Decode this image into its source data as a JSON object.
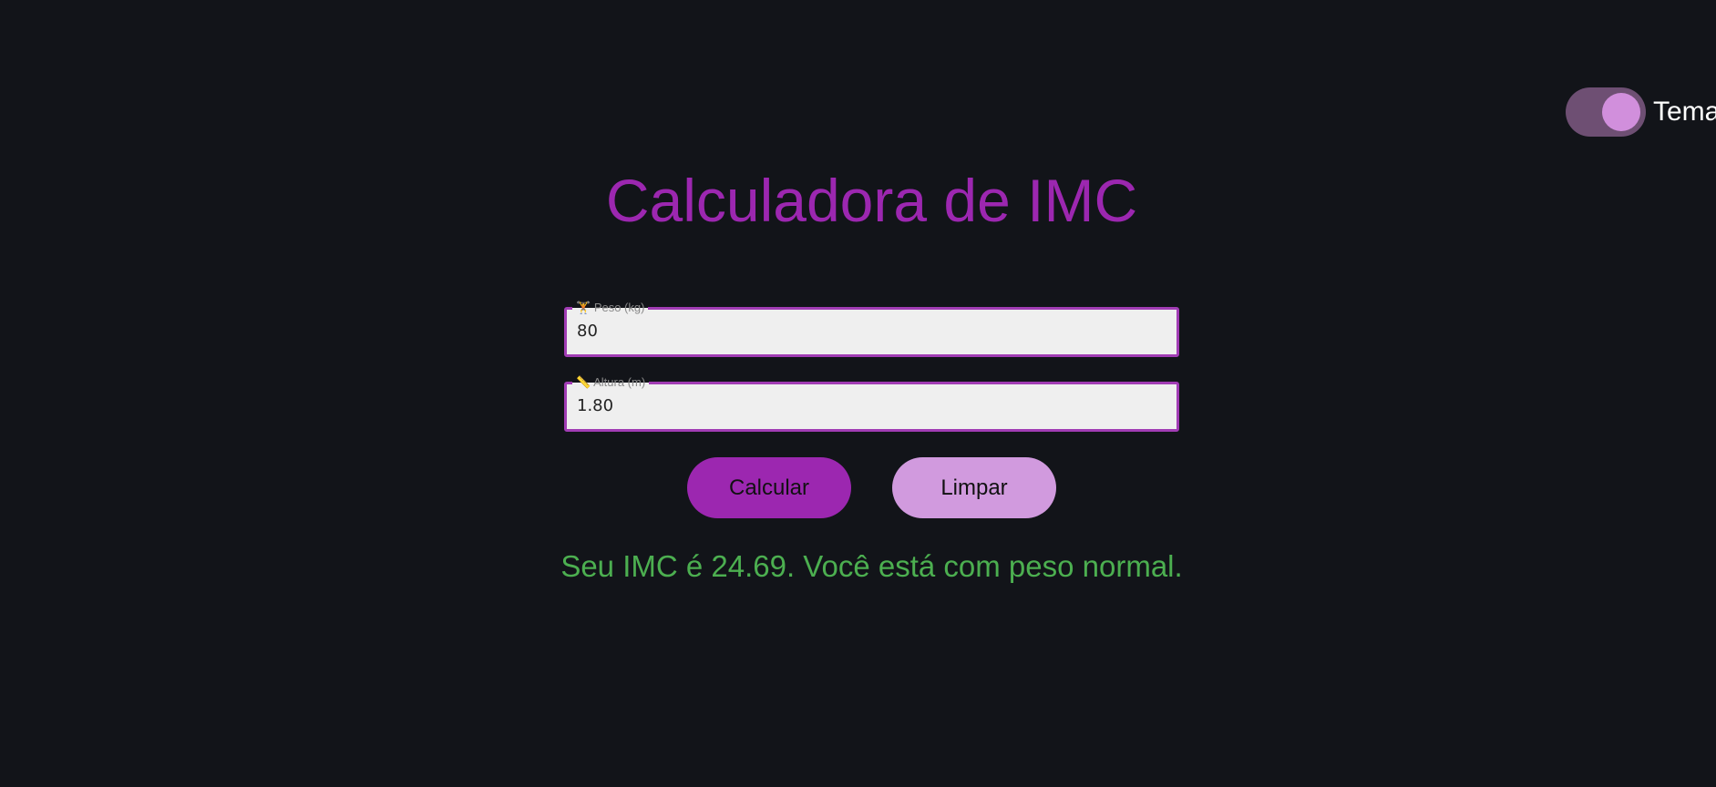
{
  "theme": {
    "label": "Tema",
    "toggle_on": true
  },
  "title": "Calculadora de IMC",
  "fields": {
    "weight": {
      "icon": "🏋",
      "label": "Peso (kg)",
      "value": "80"
    },
    "height": {
      "icon": "📏",
      "label": "Altura (m)",
      "value": "1.80"
    }
  },
  "buttons": {
    "calculate": "Calcular",
    "clear": "Limpar"
  },
  "result": "Seu IMC é 24.69. Você está com peso normal.",
  "colors": {
    "background": "#121419",
    "accent": "#9c27b0",
    "accent_light": "#d19ade",
    "success": "#4caf50"
  }
}
